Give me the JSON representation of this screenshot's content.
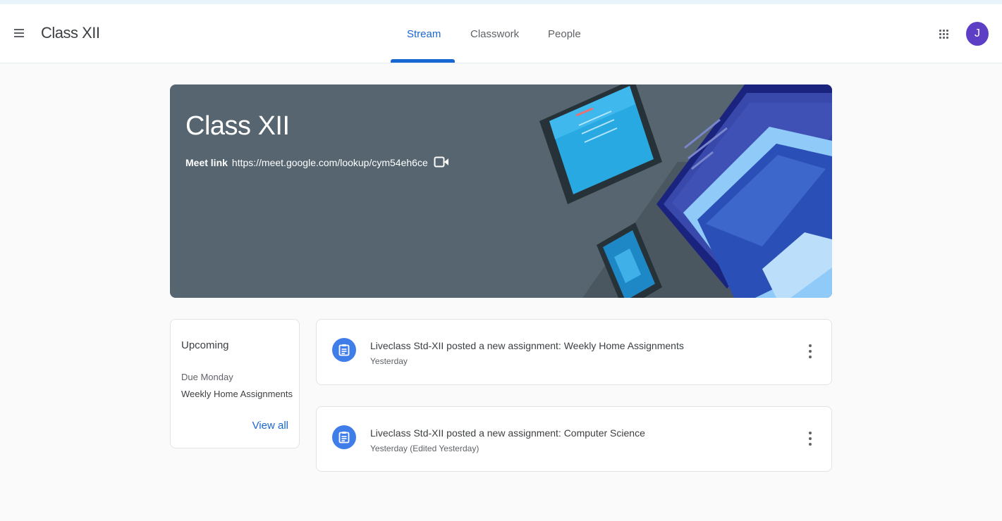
{
  "header": {
    "class_name": "Class XII",
    "tabs": [
      {
        "label": "Stream",
        "active": true
      },
      {
        "label": "Classwork",
        "active": false
      },
      {
        "label": "People",
        "active": false
      }
    ],
    "avatar_initial": "J",
    "accent_color": "#1967d2",
    "avatar_color": "#5c3fc4",
    "icons": [
      "menu-icon",
      "apps-grid-icon"
    ]
  },
  "banner": {
    "title": "Class XII",
    "meet_label": "Meet link",
    "meet_url": "https://meet.google.com/lookup/cym54eh6ce",
    "background_color": "#56656f",
    "icons": [
      "video-camera-icon"
    ]
  },
  "upcoming": {
    "title": "Upcoming",
    "due": "Due Monday",
    "item": "Weekly Home Assignments",
    "view_all": "View all"
  },
  "posts": [
    {
      "text": "Liveclass Std-XII posted a new assignment: Weekly Home Assignments",
      "time": "Yesterday",
      "icon": "assignment-icon"
    },
    {
      "text": "Liveclass Std-XII posted a new assignment: Computer Science",
      "time": "Yesterday (Edited Yesterday)",
      "icon": "assignment-icon"
    }
  ]
}
